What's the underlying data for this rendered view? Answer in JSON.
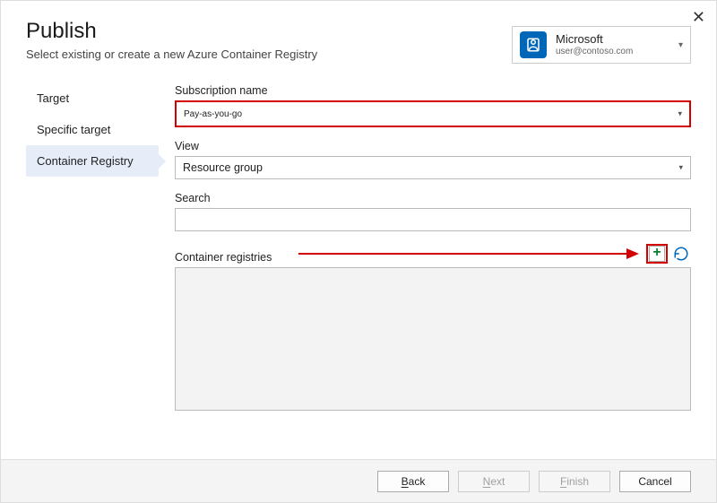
{
  "window": {
    "title": "Publish",
    "subtitle": "Select existing or create a new Azure Container Registry"
  },
  "account": {
    "name": "Microsoft",
    "email": "user@contoso.com"
  },
  "sidebar": {
    "items": [
      {
        "label": "Target",
        "selected": false
      },
      {
        "label": "Specific target",
        "selected": false
      },
      {
        "label": "Container Registry",
        "selected": true
      }
    ]
  },
  "form": {
    "subscription": {
      "label": "Subscription name",
      "value": "Pay-as-you-go"
    },
    "view": {
      "label": "View",
      "value": "Resource group"
    },
    "search": {
      "label": "Search",
      "placeholder": ""
    },
    "registries": {
      "label": "Container registries"
    }
  },
  "buttons": {
    "back": "Back",
    "next": "Next",
    "finish": "Finish",
    "cancel": "Cancel"
  }
}
